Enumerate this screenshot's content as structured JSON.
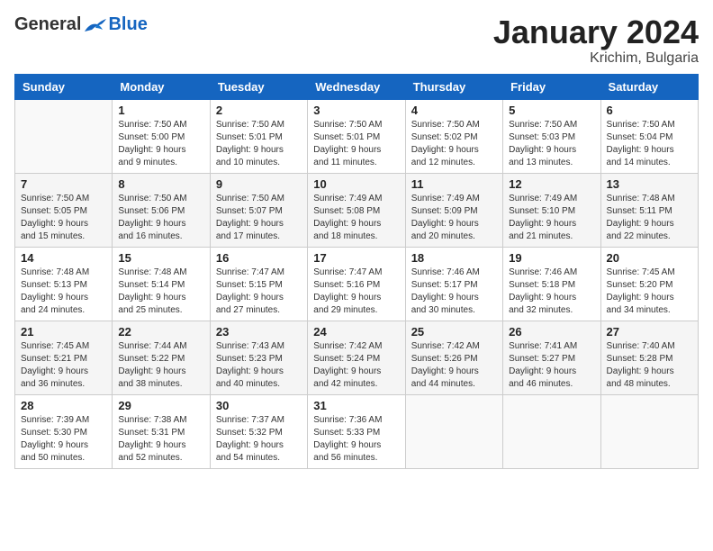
{
  "logo": {
    "general": "General",
    "blue": "Blue"
  },
  "title": "January 2024",
  "location": "Krichim, Bulgaria",
  "days_of_week": [
    "Sunday",
    "Monday",
    "Tuesday",
    "Wednesday",
    "Thursday",
    "Friday",
    "Saturday"
  ],
  "weeks": [
    [
      {
        "day": "",
        "info": ""
      },
      {
        "day": "1",
        "info": "Sunrise: 7:50 AM\nSunset: 5:00 PM\nDaylight: 9 hours\nand 9 minutes."
      },
      {
        "day": "2",
        "info": "Sunrise: 7:50 AM\nSunset: 5:01 PM\nDaylight: 9 hours\nand 10 minutes."
      },
      {
        "day": "3",
        "info": "Sunrise: 7:50 AM\nSunset: 5:01 PM\nDaylight: 9 hours\nand 11 minutes."
      },
      {
        "day": "4",
        "info": "Sunrise: 7:50 AM\nSunset: 5:02 PM\nDaylight: 9 hours\nand 12 minutes."
      },
      {
        "day": "5",
        "info": "Sunrise: 7:50 AM\nSunset: 5:03 PM\nDaylight: 9 hours\nand 13 minutes."
      },
      {
        "day": "6",
        "info": "Sunrise: 7:50 AM\nSunset: 5:04 PM\nDaylight: 9 hours\nand 14 minutes."
      }
    ],
    [
      {
        "day": "7",
        "info": "Sunrise: 7:50 AM\nSunset: 5:05 PM\nDaylight: 9 hours\nand 15 minutes."
      },
      {
        "day": "8",
        "info": "Sunrise: 7:50 AM\nSunset: 5:06 PM\nDaylight: 9 hours\nand 16 minutes."
      },
      {
        "day": "9",
        "info": "Sunrise: 7:50 AM\nSunset: 5:07 PM\nDaylight: 9 hours\nand 17 minutes."
      },
      {
        "day": "10",
        "info": "Sunrise: 7:49 AM\nSunset: 5:08 PM\nDaylight: 9 hours\nand 18 minutes."
      },
      {
        "day": "11",
        "info": "Sunrise: 7:49 AM\nSunset: 5:09 PM\nDaylight: 9 hours\nand 20 minutes."
      },
      {
        "day": "12",
        "info": "Sunrise: 7:49 AM\nSunset: 5:10 PM\nDaylight: 9 hours\nand 21 minutes."
      },
      {
        "day": "13",
        "info": "Sunrise: 7:48 AM\nSunset: 5:11 PM\nDaylight: 9 hours\nand 22 minutes."
      }
    ],
    [
      {
        "day": "14",
        "info": "Sunrise: 7:48 AM\nSunset: 5:13 PM\nDaylight: 9 hours\nand 24 minutes."
      },
      {
        "day": "15",
        "info": "Sunrise: 7:48 AM\nSunset: 5:14 PM\nDaylight: 9 hours\nand 25 minutes."
      },
      {
        "day": "16",
        "info": "Sunrise: 7:47 AM\nSunset: 5:15 PM\nDaylight: 9 hours\nand 27 minutes."
      },
      {
        "day": "17",
        "info": "Sunrise: 7:47 AM\nSunset: 5:16 PM\nDaylight: 9 hours\nand 29 minutes."
      },
      {
        "day": "18",
        "info": "Sunrise: 7:46 AM\nSunset: 5:17 PM\nDaylight: 9 hours\nand 30 minutes."
      },
      {
        "day": "19",
        "info": "Sunrise: 7:46 AM\nSunset: 5:18 PM\nDaylight: 9 hours\nand 32 minutes."
      },
      {
        "day": "20",
        "info": "Sunrise: 7:45 AM\nSunset: 5:20 PM\nDaylight: 9 hours\nand 34 minutes."
      }
    ],
    [
      {
        "day": "21",
        "info": "Sunrise: 7:45 AM\nSunset: 5:21 PM\nDaylight: 9 hours\nand 36 minutes."
      },
      {
        "day": "22",
        "info": "Sunrise: 7:44 AM\nSunset: 5:22 PM\nDaylight: 9 hours\nand 38 minutes."
      },
      {
        "day": "23",
        "info": "Sunrise: 7:43 AM\nSunset: 5:23 PM\nDaylight: 9 hours\nand 40 minutes."
      },
      {
        "day": "24",
        "info": "Sunrise: 7:42 AM\nSunset: 5:24 PM\nDaylight: 9 hours\nand 42 minutes."
      },
      {
        "day": "25",
        "info": "Sunrise: 7:42 AM\nSunset: 5:26 PM\nDaylight: 9 hours\nand 44 minutes."
      },
      {
        "day": "26",
        "info": "Sunrise: 7:41 AM\nSunset: 5:27 PM\nDaylight: 9 hours\nand 46 minutes."
      },
      {
        "day": "27",
        "info": "Sunrise: 7:40 AM\nSunset: 5:28 PM\nDaylight: 9 hours\nand 48 minutes."
      }
    ],
    [
      {
        "day": "28",
        "info": "Sunrise: 7:39 AM\nSunset: 5:30 PM\nDaylight: 9 hours\nand 50 minutes."
      },
      {
        "day": "29",
        "info": "Sunrise: 7:38 AM\nSunset: 5:31 PM\nDaylight: 9 hours\nand 52 minutes."
      },
      {
        "day": "30",
        "info": "Sunrise: 7:37 AM\nSunset: 5:32 PM\nDaylight: 9 hours\nand 54 minutes."
      },
      {
        "day": "31",
        "info": "Sunrise: 7:36 AM\nSunset: 5:33 PM\nDaylight: 9 hours\nand 56 minutes."
      },
      {
        "day": "",
        "info": ""
      },
      {
        "day": "",
        "info": ""
      },
      {
        "day": "",
        "info": ""
      }
    ]
  ]
}
